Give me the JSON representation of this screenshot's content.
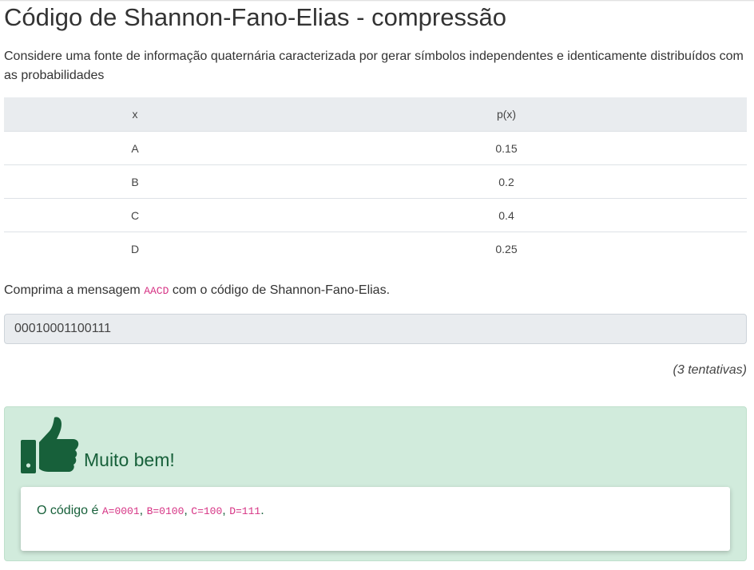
{
  "title": "Código de Shannon-Fano-Elias - compressão",
  "intro": "Considere uma fonte de informação quaternária caracterizada por gerar símbolos independentes e identicamente distribuídos com as probabilidades",
  "table": {
    "headers": [
      "x",
      "p(x)"
    ],
    "rows": [
      [
        "A",
        "0.15"
      ],
      [
        "B",
        "0.2"
      ],
      [
        "C",
        "0.4"
      ],
      [
        "D",
        "0.25"
      ]
    ]
  },
  "question": {
    "before": "Comprima a mensagem",
    "message": "AACD",
    "after": "com o código de Shannon-Fano-Elias."
  },
  "answer": {
    "value": "00010001100111"
  },
  "attempts": "(3 tentativas)",
  "feedback": {
    "title": "Muito bem!",
    "text_prefix": "O código é",
    "codes": [
      "A=0001",
      "B=0100",
      "C=100",
      "D=111"
    ],
    "separator": ",",
    "end": ".",
    "icon": "thumbs-up-icon"
  },
  "colors": {
    "success_bg": "#d1ebdc",
    "success_text": "#17603a",
    "code_text": "#d63384",
    "table_header_bg": "#e9ecef"
  }
}
